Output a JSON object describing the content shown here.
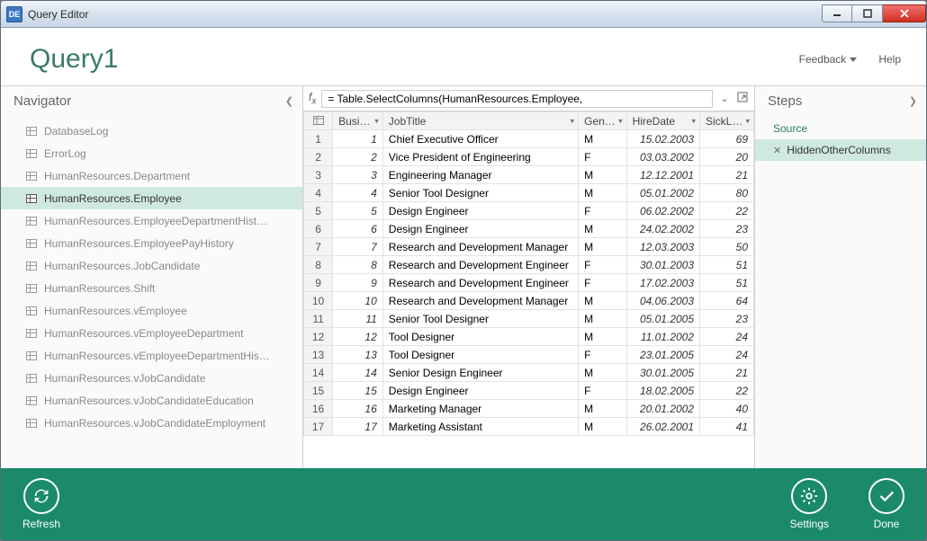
{
  "window": {
    "title": "Query Editor"
  },
  "header": {
    "title": "Query1",
    "feedback": "Feedback",
    "help": "Help"
  },
  "navigator": {
    "title": "Navigator",
    "selectedIndex": 3,
    "items": [
      "DatabaseLog",
      "ErrorLog",
      "HumanResources.Department",
      "HumanResources.Employee",
      "HumanResources.EmployeeDepartmentHist…",
      "HumanResources.EmployeePayHistory",
      "HumanResources.JobCandidate",
      "HumanResources.Shift",
      "HumanResources.vEmployee",
      "HumanResources.vEmployeeDepartment",
      "HumanResources.vEmployeeDepartmentHis…",
      "HumanResources.vJobCandidate",
      "HumanResources.vJobCandidateEducation",
      "HumanResources.vJobCandidateEmployment"
    ]
  },
  "formula": "= Table.SelectColumns(HumanResources.Employee,",
  "columns": [
    "Busi…",
    "JobTitle",
    "Gen…",
    "HireDate",
    "SickLe…"
  ],
  "rows": [
    {
      "n": 1,
      "b": 1,
      "title": "Chief Executive Officer",
      "g": "M",
      "hire": "15.02.2003",
      "sick": 69
    },
    {
      "n": 2,
      "b": 2,
      "title": "Vice President of Engineering",
      "g": "F",
      "hire": "03.03.2002",
      "sick": 20
    },
    {
      "n": 3,
      "b": 3,
      "title": "Engineering Manager",
      "g": "M",
      "hire": "12.12.2001",
      "sick": 21
    },
    {
      "n": 4,
      "b": 4,
      "title": "Senior Tool Designer",
      "g": "M",
      "hire": "05.01.2002",
      "sick": 80
    },
    {
      "n": 5,
      "b": 5,
      "title": "Design Engineer",
      "g": "F",
      "hire": "06.02.2002",
      "sick": 22
    },
    {
      "n": 6,
      "b": 6,
      "title": "Design Engineer",
      "g": "M",
      "hire": "24.02.2002",
      "sick": 23
    },
    {
      "n": 7,
      "b": 7,
      "title": "Research and Development Manager",
      "g": "M",
      "hire": "12.03.2003",
      "sick": 50
    },
    {
      "n": 8,
      "b": 8,
      "title": "Research and Development Engineer",
      "g": "F",
      "hire": "30.01.2003",
      "sick": 51
    },
    {
      "n": 9,
      "b": 9,
      "title": "Research and Development Engineer",
      "g": "F",
      "hire": "17.02.2003",
      "sick": 51
    },
    {
      "n": 10,
      "b": 10,
      "title": "Research and Development Manager",
      "g": "M",
      "hire": "04.06.2003",
      "sick": 64
    },
    {
      "n": 11,
      "b": 11,
      "title": "Senior Tool Designer",
      "g": "M",
      "hire": "05.01.2005",
      "sick": 23
    },
    {
      "n": 12,
      "b": 12,
      "title": "Tool Designer",
      "g": "M",
      "hire": "11.01.2002",
      "sick": 24
    },
    {
      "n": 13,
      "b": 13,
      "title": "Tool Designer",
      "g": "F",
      "hire": "23.01.2005",
      "sick": 24
    },
    {
      "n": 14,
      "b": 14,
      "title": "Senior Design Engineer",
      "g": "M",
      "hire": "30.01.2005",
      "sick": 21
    },
    {
      "n": 15,
      "b": 15,
      "title": "Design Engineer",
      "g": "F",
      "hire": "18.02.2005",
      "sick": 22
    },
    {
      "n": 16,
      "b": 16,
      "title": "Marketing Manager",
      "g": "M",
      "hire": "20.01.2002",
      "sick": 40
    },
    {
      "n": 17,
      "b": 17,
      "title": "Marketing Assistant",
      "g": "M",
      "hire": "26.02.2001",
      "sick": 41
    }
  ],
  "steps": {
    "title": "Steps",
    "items": [
      "Source",
      "HiddenOtherColumns"
    ],
    "selectedIndex": 1
  },
  "footer": {
    "refresh": "Refresh",
    "settings": "Settings",
    "done": "Done"
  }
}
